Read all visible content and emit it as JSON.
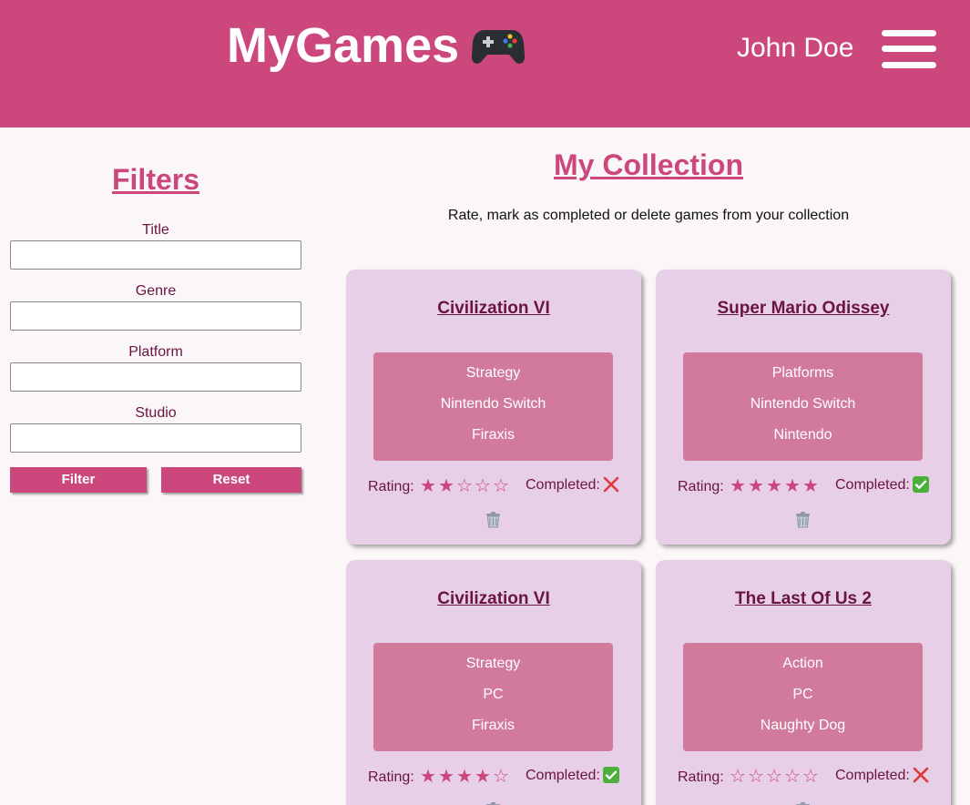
{
  "header": {
    "brand": "MyGames",
    "user_name": "John Doe"
  },
  "icons": {
    "brand_icon": "gamepad-icon",
    "menu_icon": "hamburger-menu-icon",
    "completed_true": "green-check-icon",
    "completed_false": "red-x-icon",
    "delete": "trash-can-icon"
  },
  "colors": {
    "primary": "#cc477c",
    "card_background": "#e8cfe8",
    "info_box": "#d27a9c",
    "dark_text": "#6a1440"
  },
  "filters": {
    "title": "Filters",
    "fields": [
      {
        "label": "Title",
        "value": "",
        "placeholder": ""
      },
      {
        "label": "Genre",
        "value": "",
        "placeholder": ""
      },
      {
        "label": "Platform",
        "value": "",
        "placeholder": ""
      },
      {
        "label": "Studio",
        "value": "",
        "placeholder": ""
      }
    ],
    "filter_button": "Filter",
    "reset_button": "Reset"
  },
  "collection": {
    "title": "My Collection",
    "subtitle": "Rate, mark as completed or delete games from your collection",
    "rating_label": "Rating:",
    "completed_label": "Completed:",
    "max_rating": 5,
    "games": [
      {
        "title": "Civilization VI",
        "genre": "Strategy",
        "platform": "Nintendo Switch",
        "studio": "Firaxis",
        "rating": 2,
        "completed": false
      },
      {
        "title": "Super Mario Odissey",
        "genre": "Platforms",
        "platform": "Nintendo Switch",
        "studio": "Nintendo",
        "rating": 5,
        "completed": true
      },
      {
        "title": "Civilization VI",
        "genre": "Strategy",
        "platform": "PC",
        "studio": "Firaxis",
        "rating": 4,
        "completed": true
      },
      {
        "title": "The Last Of Us 2",
        "genre": "Action",
        "platform": "PC",
        "studio": "Naughty Dog",
        "rating": 0,
        "completed": false
      }
    ]
  }
}
